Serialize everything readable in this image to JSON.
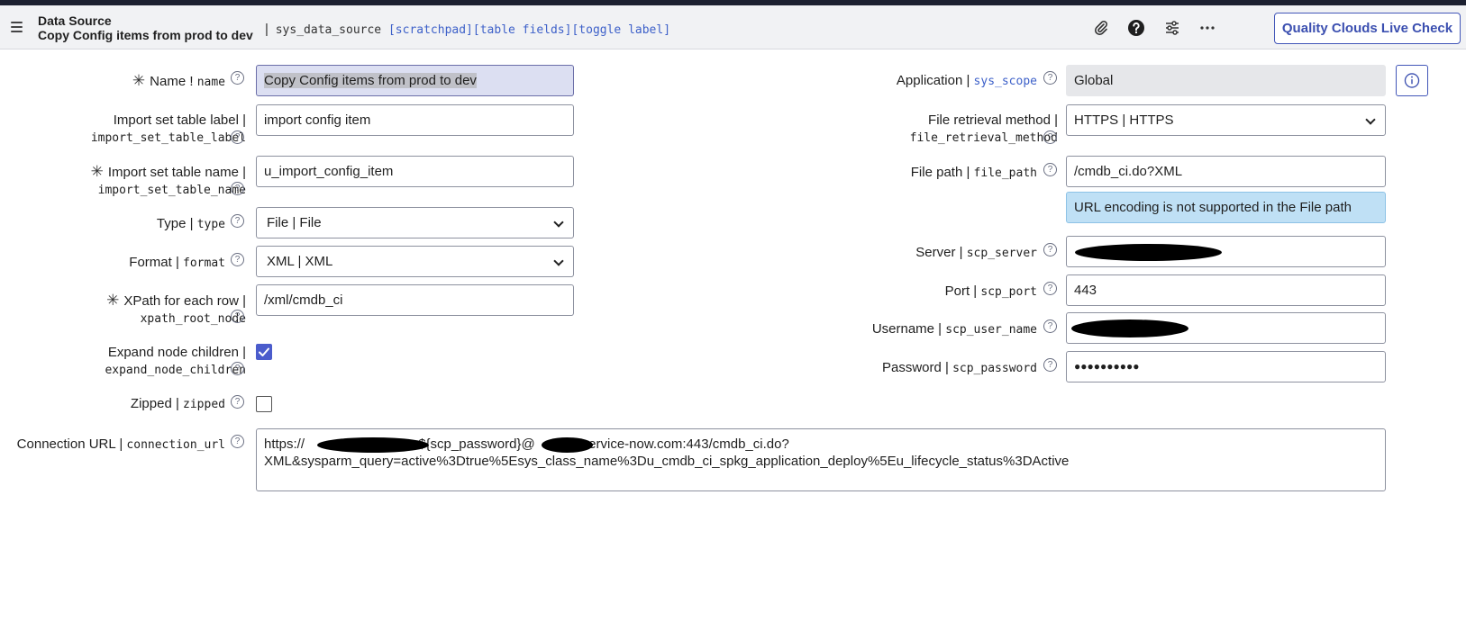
{
  "header": {
    "record_kind": "Data Source",
    "record_title": "Copy Config items from prod to dev",
    "separator": "|",
    "table_name": "sys_data_source",
    "links": [
      "[scratchpad]",
      "[table fields]",
      "[toggle label]"
    ],
    "quality_button": "Quality Clouds Live Check"
  },
  "form": {
    "name": {
      "label": "Name !",
      "code": "name",
      "value": "Copy Config items from prod to dev",
      "required": "✳"
    },
    "import_label": {
      "label": "Import set table label |",
      "code": "import_set_table_label",
      "value": "import config  item"
    },
    "import_name": {
      "label": "Import set table name |",
      "code": "import_set_table_name",
      "value": "u_import_config_item",
      "required": "✳"
    },
    "type": {
      "label": "Type |",
      "code": "type",
      "value": "File | File"
    },
    "format": {
      "label": "Format |",
      "code": "format",
      "value": "XML | XML"
    },
    "xpath": {
      "label": "XPath for each row |",
      "code": "xpath_root_node",
      "value": "/xml/cmdb_ci",
      "required": "✳"
    },
    "expand": {
      "label": "Expand node children |",
      "code": "expand_node_children",
      "checked": true
    },
    "zipped": {
      "label": "Zipped |",
      "code": "zipped",
      "checked": false
    },
    "connection_url": {
      "label": "Connection URL |",
      "code": "connection_url",
      "line1a": "https://",
      "line1b": ":${scp_password}@",
      "line1c": "service-now.com:443/cmdb_ci.do?",
      "line2": "XML&sysparm_query=active%3Dtrue%5Esys_class_name%3Du_cmdb_ci_spkg_application_deploy%5Eu_lifecycle_status%3DActive"
    },
    "application": {
      "label": "Application |",
      "code": "sys_scope",
      "value": "Global"
    },
    "retrieval": {
      "label": "File retrieval method |",
      "code": "file_retrieval_method",
      "value": "HTTPS | HTTPS"
    },
    "file_path": {
      "label": "File path |",
      "code": "file_path",
      "value": "/cmdb_ci.do?XML",
      "note": "URL encoding is not supported in the File path"
    },
    "server": {
      "label": "Server |",
      "code": "scp_server",
      "value": ""
    },
    "port": {
      "label": "Port |",
      "code": "scp_port",
      "value": "443"
    },
    "username": {
      "label": "Username |",
      "code": "scp_user_name",
      "value": ""
    },
    "password": {
      "label": "Password |",
      "code": "scp_password",
      "value": "●●●●●●●●●●"
    }
  },
  "icons": {
    "help": "?",
    "attachment": "paperclip-icon",
    "question": "question-circle-icon",
    "personalize": "sliders-icon",
    "more": "ellipsis-icon",
    "info": "info-circle-icon"
  },
  "colors": {
    "accent": "#3b4fb0",
    "link": "#3e61c9",
    "note": "#bfe0f5",
    "checkbox": "#4b5ccc"
  }
}
